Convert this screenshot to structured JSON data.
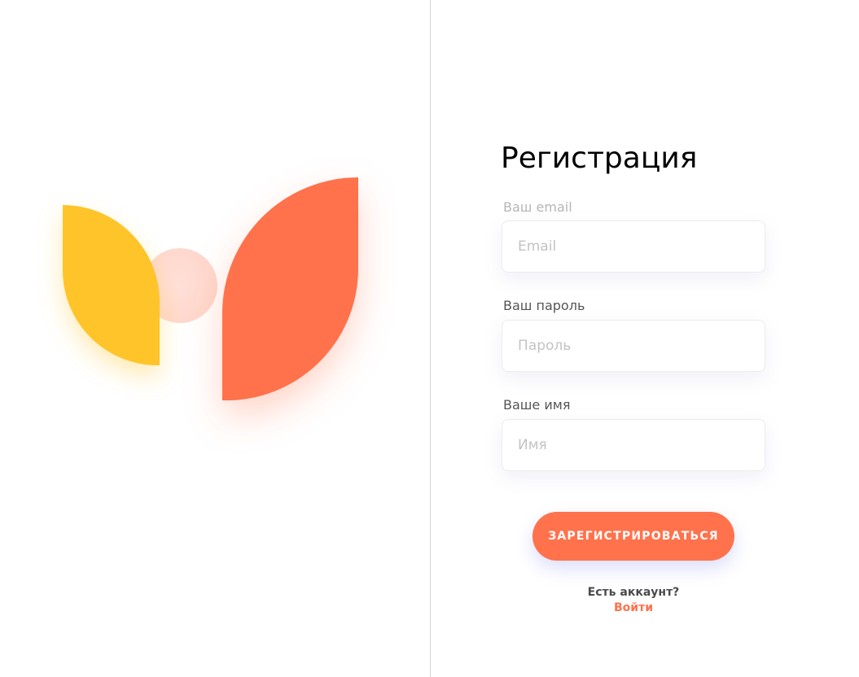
{
  "form": {
    "title": "Регистрация",
    "email": {
      "label": "Ваш email",
      "placeholder": "Email"
    },
    "password": {
      "label": "Ваш пароль",
      "placeholder": "Пароль"
    },
    "name": {
      "label": "Ваше имя",
      "placeholder": "Имя"
    },
    "submit_label": "ЗАРЕГИСТРИРОВАТЬСЯ"
  },
  "footer": {
    "question": "Есть аккаунт?",
    "login_label": "Войти"
  },
  "colors": {
    "accent": "#ff724c",
    "yellow": "#ffc42b",
    "pink_circle": "#ffd9d0",
    "divider": "#d9d9d9"
  },
  "icons": {
    "logo": "leaves-logo-icon"
  }
}
